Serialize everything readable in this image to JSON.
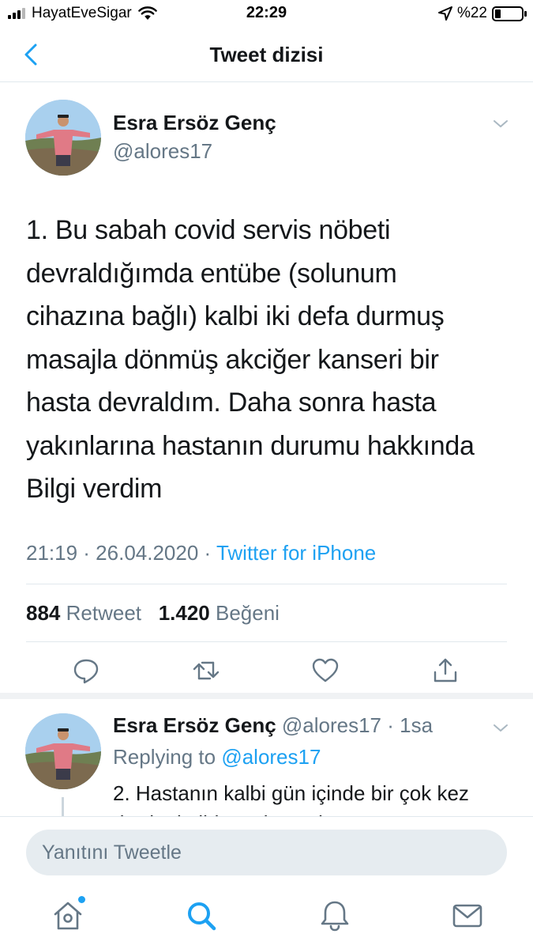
{
  "status_bar": {
    "carrier": "HayatEveSigar",
    "time": "22:29",
    "battery_text": "%22",
    "battery_level": 0.22
  },
  "nav": {
    "title": "Tweet dizisi"
  },
  "main_tweet": {
    "author_name": "Esra Ersöz Genç",
    "author_handle": "@alores17",
    "lines": [
      "1. Bu sabah covid servis nöbeti",
      "devraldığımda entübe (solunum",
      "cihazına bağlı) kalbi iki defa durmuş",
      "masajla dönmüş akciğer kanseri bir",
      "hasta devraldım. Daha sonra hasta",
      "yakınlarına hastanın durumu hakkında",
      "Bilgi verdim"
    ],
    "time_date": "21:19 · 26.04.2020 · ",
    "source": "Twitter for iPhone",
    "retweet_count": "884",
    "retweet_label": "Retweet",
    "like_count": "1.420",
    "like_label": "Beğeni"
  },
  "reply_tweet": {
    "author_name": "Esra Ersöz Genç",
    "author_handle": "@alores17",
    "time_ago": "· 1sa",
    "replying_prefix": "Replying to",
    "replying_to": "@alores17",
    "text_line1": "2. Hastanın kalbi gün içinde bir çok kez",
    "text_line2": "durdu, kalbi tansiyon oluşturamıyor"
  },
  "compose": {
    "placeholder": "Yanıtını Tweetle"
  },
  "icons": {
    "back": "chevron-left-icon",
    "caret": "chevron-down-icon",
    "reply": "comment-icon",
    "retweet": "retweet-icon",
    "like": "heart-icon",
    "share": "share-icon",
    "home": "home-icon",
    "search": "search-icon",
    "notifications": "bell-icon",
    "messages": "mail-icon"
  },
  "colors": {
    "accent": "#1da1f2",
    "secondary_text": "#657786",
    "primary_text": "#14171a"
  }
}
